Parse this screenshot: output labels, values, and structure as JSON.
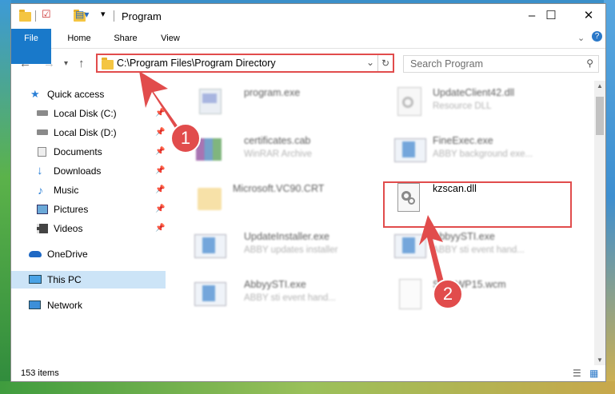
{
  "window": {
    "title": "Program",
    "controls": {
      "minimize": "–",
      "maximize": "☐",
      "close": "✕"
    }
  },
  "ribbon": {
    "tabs": [
      {
        "label": "File"
      },
      {
        "label": "Home"
      },
      {
        "label": "Share"
      },
      {
        "label": "View"
      }
    ]
  },
  "address": {
    "path": "C:\\Program Files\\Program Directory",
    "search_placeholder": "Search Program"
  },
  "sidebar": {
    "items": [
      {
        "label": "Quick access",
        "icon": "star-icon"
      },
      {
        "label": "Local Disk (C:)",
        "icon": "drive-icon",
        "pinned": true
      },
      {
        "label": "Local Disk (D:)",
        "icon": "drive-icon",
        "pinned": true
      },
      {
        "label": "Documents",
        "icon": "documents-icon",
        "pinned": true
      },
      {
        "label": "Downloads",
        "icon": "download-icon",
        "pinned": true
      },
      {
        "label": "Music",
        "icon": "music-icon",
        "pinned": true
      },
      {
        "label": "Pictures",
        "icon": "pictures-icon",
        "pinned": true
      },
      {
        "label": "Videos",
        "icon": "videos-icon",
        "pinned": true
      },
      {
        "label": "OneDrive",
        "icon": "cloud-icon"
      },
      {
        "label": "This PC",
        "icon": "pc-icon",
        "selected": true
      },
      {
        "label": "Network",
        "icon": "network-icon"
      }
    ]
  },
  "files": [
    {
      "name": "program.exe",
      "desc": ""
    },
    {
      "name": "UpdateClient42.dll",
      "desc": "Resource DLL"
    },
    {
      "name": "certificates.cab",
      "desc": "WinRAR Archive"
    },
    {
      "name": "FineExec.exe",
      "desc": "ABBY background exe..."
    },
    {
      "name": "Microsoft.VC90.CRT",
      "desc": ""
    },
    {
      "name": "kzscan.dll",
      "desc": ""
    },
    {
      "name": "UpdateInstaller.exe",
      "desc": "ABBY updates installer"
    },
    {
      "name": "AbbyySTI.exe",
      "desc": "ABBY sti event hand..."
    },
    {
      "name": "AbbyySTI.exe",
      "desc": "ABBY sti event hand..."
    },
    {
      "name": "ScanWP15.wcm",
      "desc": ""
    }
  ],
  "status": {
    "count": "153 items"
  },
  "markers": [
    "1",
    "2"
  ],
  "colors": {
    "accent": "#1979ca",
    "highlight": "#e14c4c",
    "selected": "#cce4f7"
  }
}
